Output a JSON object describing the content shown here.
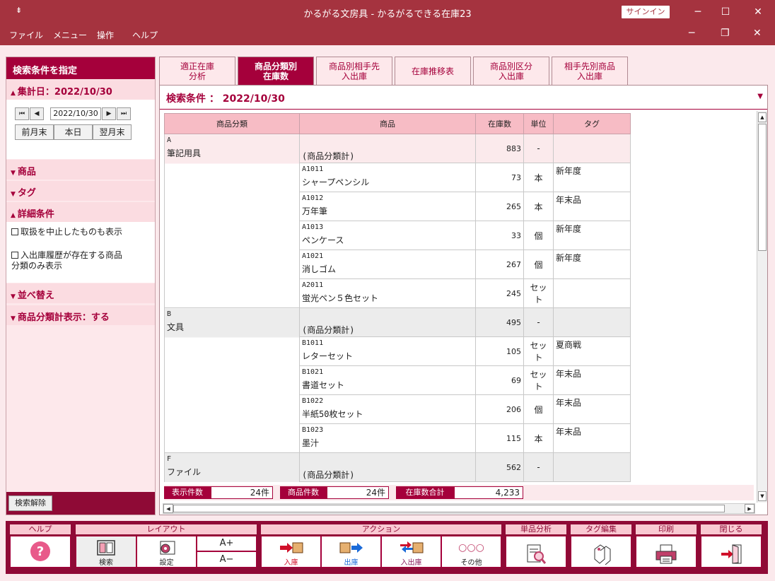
{
  "window": {
    "title": "かるがる文房具 - かるがるできる在庫23",
    "signin": "サインイン",
    "sysmenu": "⇟",
    "minimize": "─",
    "maximize": "☐",
    "close": "✕"
  },
  "menu": {
    "items": [
      "ファイル",
      "メニュー",
      "操作",
      "ヘルプ"
    ],
    "mdi_minimize": "─",
    "mdi_restore": "❐",
    "mdi_close": "✕"
  },
  "left": {
    "header": "検索条件を指定",
    "date_section": "集計日：2022/10/30",
    "date_value": "2022/10/30",
    "nav": {
      "first": "⏮",
      "prev": "◀",
      "next": "▶",
      "last": "⏭"
    },
    "date_buttons": [
      "前月末",
      "本日",
      "翌月末"
    ],
    "sections": {
      "product": "商品",
      "tag": "タグ",
      "detail": "詳細条件",
      "sort": "並べ替え",
      "subtotal": "商品分類計表示：する"
    },
    "checkboxes": [
      "取扱を中止したものも表示",
      "入出庫履歴が存在する商品\n分類のみ表示"
    ],
    "clear_button": "検索解除"
  },
  "tabs": [
    "適正在庫\n分析",
    "商品分類別\n在庫数",
    "商品別相手先\n入出庫",
    "在庫推移表",
    "商品別区分\n入出庫",
    "相手先別商品\n入出庫"
  ],
  "condition": "検索条件 ： 2022/10/30",
  "table": {
    "headers": [
      "商品分類",
      "商品",
      "在庫数",
      "単位",
      "タグ"
    ],
    "groups": [
      {
        "code": "A",
        "name": "筆記用具",
        "subtotal_label": "(商品分類計)",
        "subtotal": "883",
        "subtotal_unit": "-",
        "style": "cat",
        "rows": [
          {
            "code": "A1011",
            "name": "シャープペンシル",
            "qty": "73",
            "unit": "本",
            "tag": "新年度"
          },
          {
            "code": "A1012",
            "name": "万年筆",
            "qty": "265",
            "unit": "本",
            "tag": "年末品"
          },
          {
            "code": "A1013",
            "name": "ペンケース",
            "qty": "33",
            "unit": "個",
            "tag": "新年度"
          },
          {
            "code": "A1021",
            "name": "消しゴム",
            "qty": "267",
            "unit": "個",
            "tag": "新年度"
          },
          {
            "code": "A2011",
            "name": "蛍光ペン５色セット",
            "qty": "245",
            "unit": "セット",
            "tag": ""
          }
        ]
      },
      {
        "code": "B",
        "name": "文具",
        "subtotal_label": "(商品分類計)",
        "subtotal": "495",
        "subtotal_unit": "-",
        "style": "cat2",
        "rows": [
          {
            "code": "B1011",
            "name": "レターセット",
            "qty": "105",
            "unit": "セット",
            "tag": "夏商戦"
          },
          {
            "code": "B1021",
            "name": "書道セット",
            "qty": "69",
            "unit": "セット",
            "tag": "年末品"
          },
          {
            "code": "B1022",
            "name": "半紙50枚セット",
            "qty": "206",
            "unit": "個",
            "tag": "年末品"
          },
          {
            "code": "B1023",
            "name": "墨汁",
            "qty": "115",
            "unit": "本",
            "tag": "年末品"
          }
        ]
      },
      {
        "code": "F",
        "name": "ファイル",
        "subtotal_label": "(商品分類計)",
        "subtotal": "562",
        "subtotal_unit": "-",
        "style": "cat2",
        "rows": []
      }
    ]
  },
  "status": {
    "count_label": "表示件数",
    "count": "24件",
    "items_label": "商品件数",
    "items": "24件",
    "total_label": "在庫数合計",
    "total": "4,233"
  },
  "toolbar": {
    "groups": {
      "help": "ヘルプ",
      "layout": "レイアウト",
      "action": "アクション",
      "analysis": "単品分析",
      "tagedit": "タグ編集",
      "print": "印刷",
      "close": "閉じる"
    },
    "buttons": {
      "search": "検索",
      "settings": "設定",
      "font_up": "A+",
      "font_down": "A−",
      "in": "入庫",
      "out": "出庫",
      "inout": "入出庫",
      "other": "その他"
    }
  },
  "colors": {
    "titlebar": "#a5333f",
    "accent": "#a5003b",
    "header_row": "#f7bcc5",
    "panel": "#fde8eb"
  }
}
